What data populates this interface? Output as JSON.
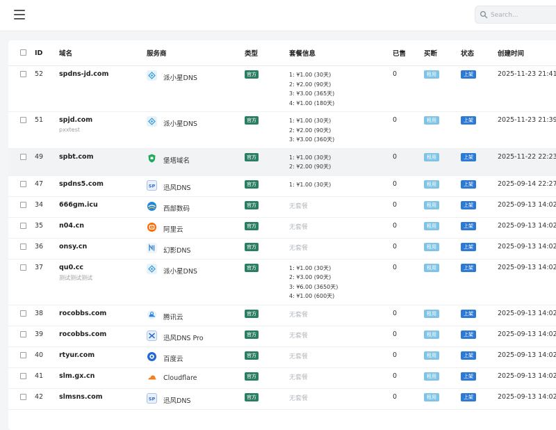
{
  "header": {
    "search_placeholder": "Search..."
  },
  "table": {
    "columns": [
      "ID",
      "域名",
      "服务商",
      "类型",
      "套餐信息",
      "已售",
      "买断",
      "状态",
      "创建时间"
    ],
    "rows": [
      {
        "id": "52",
        "domain": "spdns-jd.com",
        "note": "",
        "provider": "派小星DNS",
        "icon": "pxx",
        "type": "官方",
        "plans": [
          "1: ¥1.00 (30天)",
          "2: ¥2.00 (90天)",
          "3: ¥3.00 (365天)",
          "4: ¥1.00 (180天)"
        ],
        "sold": "0",
        "buyout": "租用",
        "status": "上架",
        "created": "2025-11-23 21:41"
      },
      {
        "id": "51",
        "domain": "spjd.com",
        "note": "pxxtest",
        "provider": "派小星DNS",
        "icon": "pxx",
        "type": "官方",
        "plans": [
          "1: ¥1.00 (30天)",
          "2: ¥2.00 (90天)",
          "3: ¥3.00 (360天)"
        ],
        "sold": "0",
        "buyout": "租用",
        "status": "上架",
        "created": "2025-11-23 21:39"
      },
      {
        "id": "49",
        "domain": "spbt.com",
        "note": "",
        "provider": "堡塔域名",
        "icon": "bt",
        "type": "官方",
        "plans": [
          "1: ¥1.00 (30天)",
          "2: ¥2.00 (90天)"
        ],
        "sold": "0",
        "buyout": "租用",
        "status": "上架",
        "created": "2025-11-22 22:23"
      },
      {
        "id": "47",
        "domain": "spdns5.com",
        "note": "",
        "provider": "迅风DNS",
        "icon": "sp",
        "type": "官方",
        "plans": [
          "1: ¥1.00 (30天)"
        ],
        "sold": "0",
        "buyout": "租用",
        "status": "上架",
        "created": "2025-09-14 22:27"
      },
      {
        "id": "34",
        "domain": "666gm.icu",
        "note": "",
        "provider": "西部数码",
        "icon": "west",
        "type": "官方",
        "plans": [],
        "sold": "0",
        "buyout": "租用",
        "status": "上架",
        "created": "2025-09-13 14:02"
      },
      {
        "id": "35",
        "domain": "n04.cn",
        "note": "",
        "provider": "阿里云",
        "icon": "ali",
        "type": "官方",
        "plans": [],
        "sold": "0",
        "buyout": "租用",
        "status": "上架",
        "created": "2025-09-13 14:02"
      },
      {
        "id": "36",
        "domain": "onsy.cn",
        "note": "",
        "provider": "幻影DNS",
        "icon": "hy",
        "type": "官方",
        "plans": [],
        "sold": "0",
        "buyout": "租用",
        "status": "上架",
        "created": "2025-09-13 14:02"
      },
      {
        "id": "37",
        "domain": "qu0.cc",
        "note": "测试测试测试",
        "provider": "派小星DNS",
        "icon": "pxx",
        "type": "官方",
        "plans": [
          "1: ¥1.00 (30天)",
          "2: ¥3.00 (90天)",
          "3: ¥6.00 (3650天)",
          "4: ¥1.00 (600天)"
        ],
        "sold": "0",
        "buyout": "租用",
        "status": "上架",
        "created": "2025-09-13 14:02"
      },
      {
        "id": "38",
        "domain": "rocobbs.com",
        "note": "",
        "provider": "腾讯云",
        "icon": "tx",
        "type": "官方",
        "plans": [],
        "sold": "0",
        "buyout": "租用",
        "status": "上架",
        "created": "2025-09-13 14:02"
      },
      {
        "id": "39",
        "domain": "rocobbs.com",
        "note": "",
        "provider": "迅风DNS Pro",
        "icon": "xf",
        "type": "官方",
        "plans": [],
        "sold": "0",
        "buyout": "租用",
        "status": "上架",
        "created": "2025-09-13 14:02"
      },
      {
        "id": "40",
        "domain": "rtyur.com",
        "note": "",
        "provider": "百度云",
        "icon": "bd",
        "type": "官方",
        "plans": [],
        "sold": "0",
        "buyout": "租用",
        "status": "上架",
        "created": "2025-09-13 14:02"
      },
      {
        "id": "41",
        "domain": "slm.gx.cn",
        "note": "",
        "provider": "Cloudflare",
        "icon": "cf",
        "type": "官方",
        "plans": [],
        "sold": "0",
        "buyout": "租用",
        "status": "上架",
        "created": "2025-09-13 14:02"
      },
      {
        "id": "42",
        "domain": "slmsns.com",
        "note": "",
        "provider": "迅风DNS",
        "icon": "sp",
        "type": "官方",
        "plans": [],
        "sold": "0",
        "buyout": "租用",
        "status": "上架",
        "created": "2025-09-13 14:02"
      }
    ],
    "no_plan_text": "无套餐",
    "highlight_row_id": "49"
  },
  "icons": {
    "pxx": "paixiaoxing-dns-icon",
    "bt": "baota-icon",
    "sp": "sp-dns-icon",
    "west": "west-digital-icon",
    "ali": "aliyun-icon",
    "hy": "huanying-dns-icon",
    "tx": "tencent-cloud-icon",
    "xf": "xunfeng-dns-pro-icon",
    "bd": "baidu-cloud-icon",
    "cf": "cloudflare-icon"
  },
  "colors": {
    "type_badge": "#2a7f62",
    "buyout_badge": "#7fc3e6",
    "status_badge": "#2d7ad6",
    "no_plan": "#b5bac0"
  }
}
